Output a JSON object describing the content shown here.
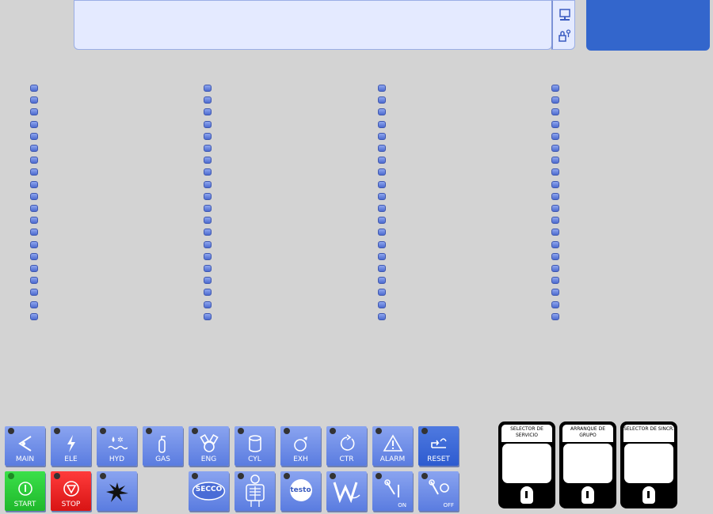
{
  "buttons_row1": [
    {
      "label": "MAIN"
    },
    {
      "label": "ELE"
    },
    {
      "label": "HYD"
    },
    {
      "label": "GAS"
    },
    {
      "label": "ENG"
    },
    {
      "label": "CYL"
    },
    {
      "label": "EXH"
    },
    {
      "label": "CTR"
    },
    {
      "label": "ALARM"
    },
    {
      "label": "RESET"
    }
  ],
  "buttons_row2": {
    "start": "START",
    "stop": "STOP",
    "secco": "SECCO",
    "testo": "testo",
    "on": "ON",
    "off": "OFF"
  },
  "selectors": [
    {
      "title": "SELECTOR DE SERVICIO"
    },
    {
      "title": "ARRANQUE DE GRUPO"
    },
    {
      "title": "SELECTOR DE SINCR."
    }
  ],
  "colors": {
    "background": "#d3d3d3",
    "button_blue": "#6f8ee8",
    "accent": "#3366cc",
    "start": "#22c02e",
    "stop": "#e01919"
  }
}
